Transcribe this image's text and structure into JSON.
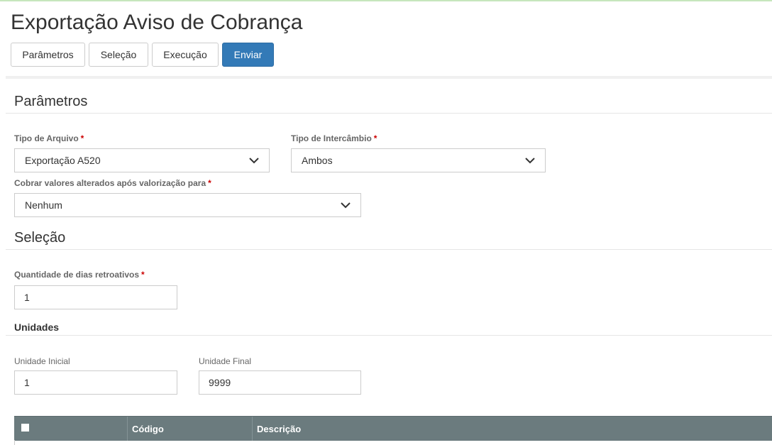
{
  "header": {
    "title": "Exportação Aviso de Cobrança",
    "tabs": [
      {
        "label": "Parâmetros"
      },
      {
        "label": "Seleção"
      },
      {
        "label": "Execução"
      },
      {
        "label": "Enviar"
      }
    ]
  },
  "parametros": {
    "section_title": "Parâmetros",
    "tipo_arquivo": {
      "label": "Tipo de Arquivo",
      "value": "Exportação A520"
    },
    "tipo_intercambio": {
      "label": "Tipo de Intercâmbio",
      "value": "Ambos"
    },
    "cobrar_valores": {
      "label": "Cobrar valores alterados após valorização para",
      "value": "Nenhum"
    }
  },
  "selecao": {
    "section_title": "Seleção",
    "dias_retroativos": {
      "label": "Quantidade de dias retroativos",
      "value": "1"
    },
    "unidades": {
      "title": "Unidades",
      "inicial": {
        "label": "Unidade Inicial",
        "value": "1"
      },
      "final": {
        "label": "Unidade Final",
        "value": "9999"
      }
    }
  },
  "table": {
    "columns": [
      "Código",
      "Descrição"
    ]
  },
  "required_marker": "*",
  "colors": {
    "primary": "#337ab7",
    "table_header": "#6b7b7e",
    "required": "#cc0000"
  }
}
